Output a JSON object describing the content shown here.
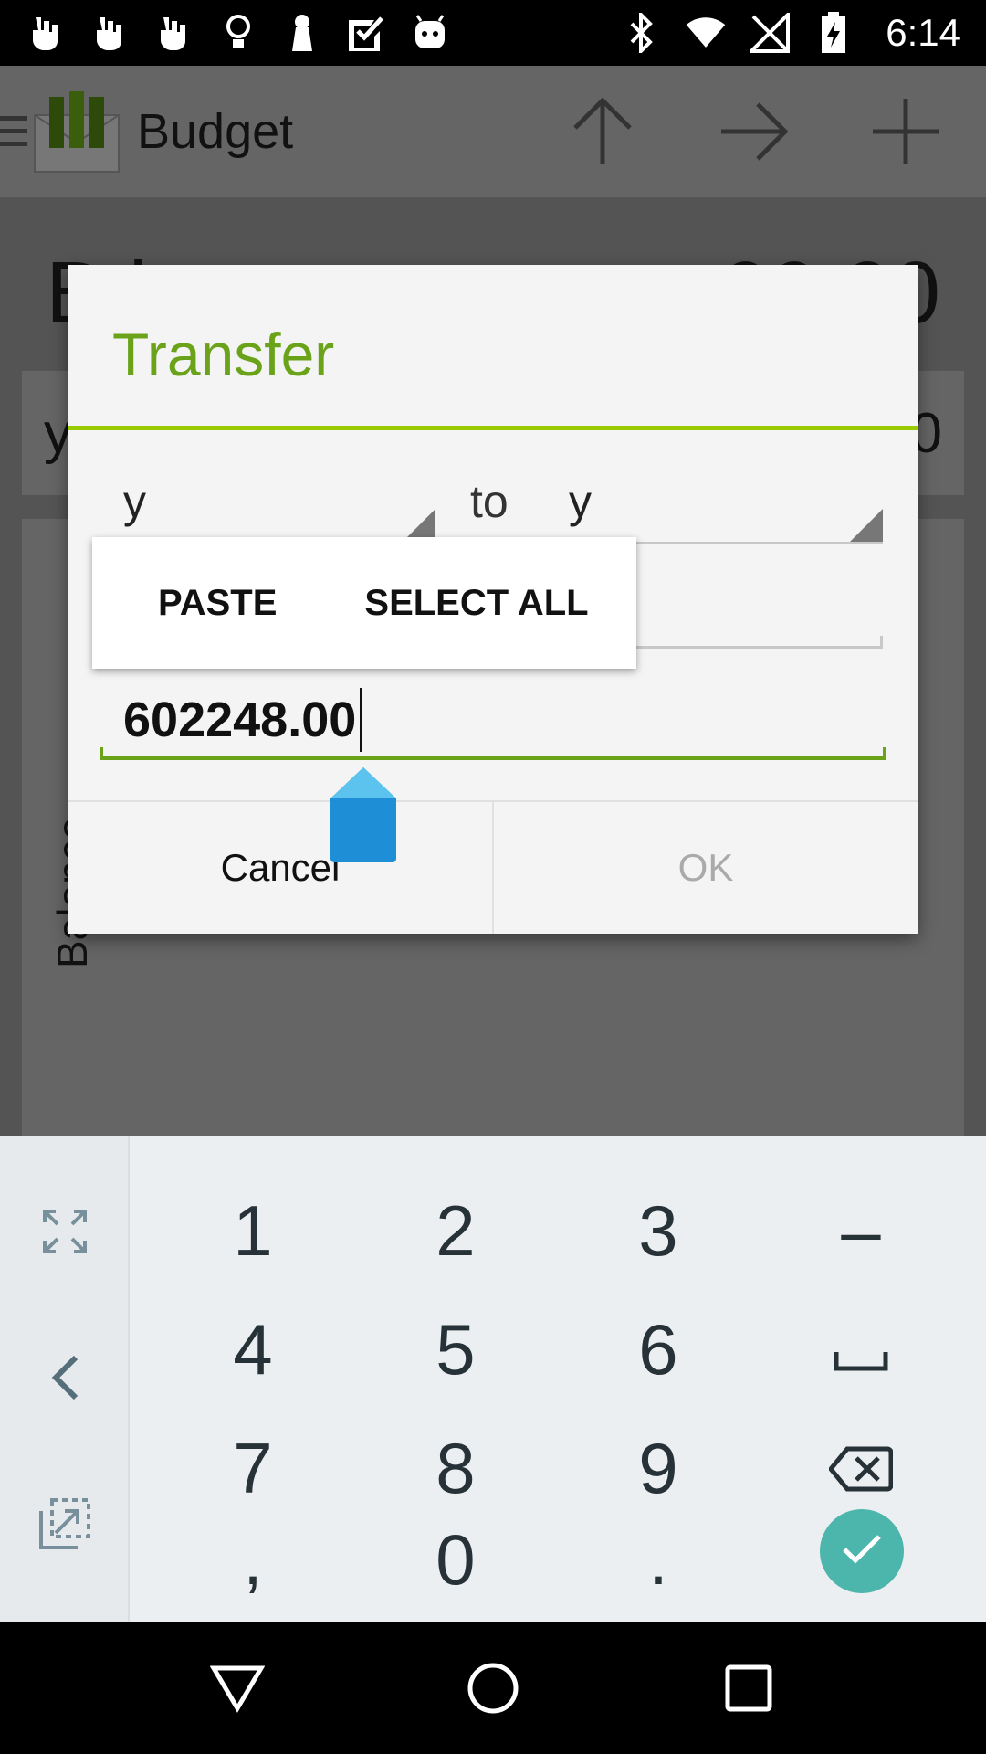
{
  "status_bar": {
    "time": "6:14",
    "left_icons": [
      "hand-icon",
      "hand-icon",
      "hand-icon",
      "bulb-icon",
      "pin-icon",
      "check-icon",
      "android-icon"
    ],
    "right_icons": [
      "bluetooth-icon",
      "wifi-icon",
      "no-signal-icon",
      "battery-charging-icon"
    ]
  },
  "app_bar": {
    "title": "Budget",
    "actions": [
      "up-arrow-icon",
      "right-arrow-icon",
      "plus-icon"
    ]
  },
  "background": {
    "balance_label": "B l",
    "balance_value": "00.00",
    "row_label": "y",
    "row_value": "0",
    "vertical_label": "Balance"
  },
  "dialog": {
    "title": "Transfer",
    "from_value": "y",
    "to_label": "to",
    "to_value": "y",
    "amount": "602248.00",
    "cancel_label": "Cancel",
    "ok_label": "OK"
  },
  "selection_popup": {
    "paste_label": "PASTE",
    "select_all_label": "SELECT ALL"
  },
  "keyboard": {
    "rows": [
      [
        "1",
        "2",
        "3",
        "–"
      ],
      [
        "4",
        "5",
        "6",
        "␣"
      ],
      [
        "7",
        "8",
        "9",
        "⌫"
      ],
      [
        ",",
        "0",
        ".",
        "✓"
      ]
    ],
    "accent_color": "#4db6ac"
  },
  "colors": {
    "accent_green": "#6aa31a",
    "divider_green": "#99cc00"
  }
}
